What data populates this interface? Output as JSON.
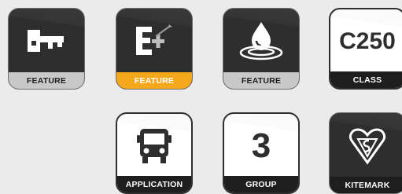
{
  "tiles": [
    {
      "label": "FEATURE",
      "icon": "key-icon"
    },
    {
      "label": "FEATURE",
      "icon": "electric-plus-icon"
    },
    {
      "label": "FEATURE",
      "icon": "water-drop-icon"
    },
    {
      "label": "CLASS",
      "value": "C250"
    },
    {
      "label": "APPLICATION",
      "icon": "bus-icon"
    },
    {
      "label": "GROUP",
      "value": "3"
    },
    {
      "label": "KITEMARK",
      "icon": "kitemark-icon"
    }
  ],
  "colors": {
    "dark_tile": "#2e2e2e",
    "label_grey": "#c8c8c8",
    "label_orange": "#f5a81c",
    "label_black": "#1e1e1e"
  }
}
